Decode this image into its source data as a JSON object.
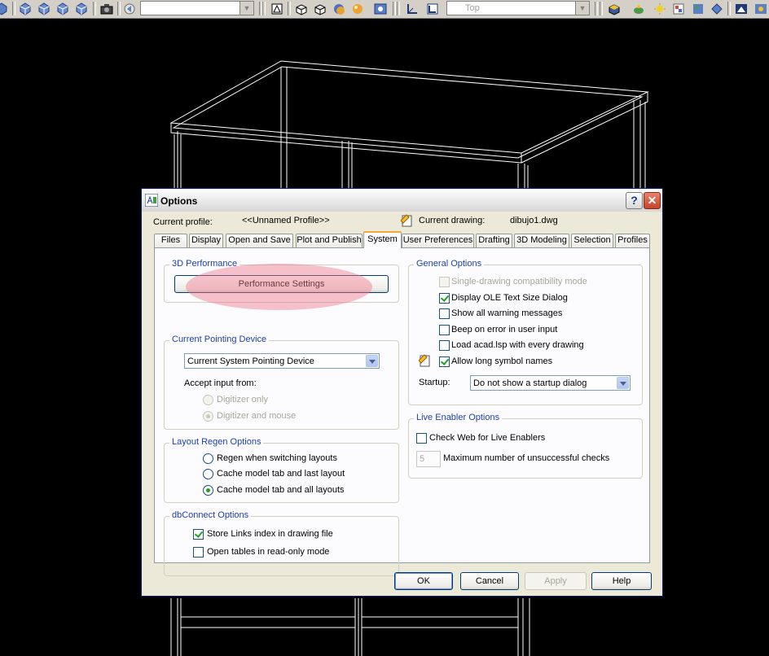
{
  "toolbar": {
    "combo1_value": "",
    "view_combo_value": "Top"
  },
  "dialog": {
    "title": "Options",
    "current_profile_label": "Current profile:",
    "current_profile_value": "<<Unnamed Profile>>",
    "current_drawing_label": "Current drawing:",
    "current_drawing_value": "dibujo1.dwg",
    "tabs": [
      "Files",
      "Display",
      "Open and Save",
      "Plot and Publish",
      "System",
      "User Preferences",
      "Drafting",
      "3D Modeling",
      "Selection",
      "Profiles"
    ],
    "active_tab": "System"
  },
  "performance": {
    "title": "3D Performance",
    "button": "Performance Settings"
  },
  "pointing": {
    "title": "Current Pointing Device",
    "device": "Current System Pointing Device",
    "accept_label": "Accept input from:",
    "digitizer_only": "Digitizer only",
    "digitizer_mouse": "Digitizer and mouse"
  },
  "layout_regen": {
    "title": "Layout Regen Options",
    "opt1": "Regen when switching layouts",
    "opt2": "Cache model tab and last layout",
    "opt3": "Cache model tab and all layouts"
  },
  "dbconnect": {
    "title": "dbConnect Options",
    "opt1": "Store Links index in drawing file",
    "opt2": "Open tables in read-only mode"
  },
  "general": {
    "title": "General Options",
    "opt1": "Single-drawing compatibility mode",
    "opt2": "Display OLE Text Size Dialog",
    "opt3": "Show all warning messages",
    "opt4": "Beep on error in user input",
    "opt5": "Load acad.lsp with every drawing",
    "opt6": "Allow long symbol names",
    "startup_label": "Startup:",
    "startup_value": "Do not show a startup dialog"
  },
  "live_enabler": {
    "title": "Live Enabler Options",
    "check_web": "Check Web for Live Enablers",
    "max_checks_value": "5",
    "max_checks_label": "Maximum number of unsuccessful checks"
  },
  "buttons": {
    "ok": "OK",
    "cancel": "Cancel",
    "apply": "Apply",
    "help": "Help"
  },
  "colors": {
    "group_title": "#1e3fa8",
    "tab_active_accent": "#f5a837",
    "highlight": "#f0788c"
  }
}
